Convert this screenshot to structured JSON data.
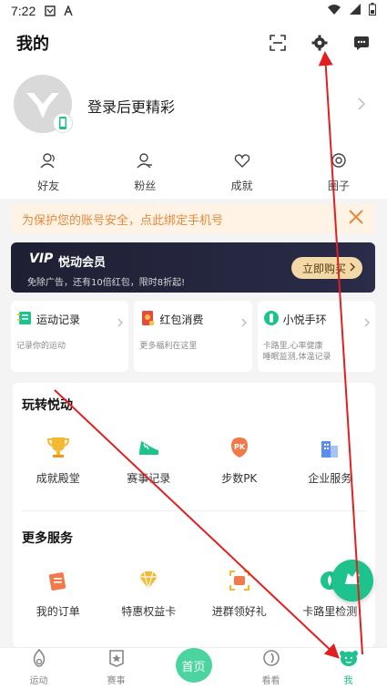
{
  "status_bar": {
    "time": "7:22"
  },
  "header": {
    "title": "我的"
  },
  "profile": {
    "login_text": "登录后更精彩"
  },
  "stats": [
    {
      "label": "好友",
      "icon": "friends-icon"
    },
    {
      "label": "粉丝",
      "icon": "fans-icon"
    },
    {
      "label": "成就",
      "icon": "heart-icon"
    },
    {
      "label": "圈子",
      "icon": "circle-icon"
    }
  ],
  "security_banner": {
    "text": "为保护您的账号安全，点此绑定手机号"
  },
  "vip": {
    "logo": "VIP",
    "title": "悦动会员",
    "subtitle": "免除广告，还有10倍红包，限时8折起!",
    "buy_label": "立即购买"
  },
  "shortcuts": [
    {
      "title": "运动记录",
      "desc": "记录你的运动"
    },
    {
      "title": "红包消费",
      "desc": "更多福利在这里"
    },
    {
      "title": "小悦手环",
      "desc": "卡路里,心率健康\n睡眠监测,体温记录"
    }
  ],
  "play": {
    "title": "玩转悦动",
    "items": [
      {
        "label": "成就殿堂",
        "icon": "trophy-icon"
      },
      {
        "label": "赛事记录",
        "icon": "shoe-icon"
      },
      {
        "label": "步数PK",
        "icon": "pk-icon"
      },
      {
        "label": "企业服务",
        "icon": "building-icon"
      }
    ]
  },
  "more": {
    "title": "更多服务",
    "items": [
      {
        "label": "我的订单",
        "icon": "order-icon"
      },
      {
        "label": "特惠权益卡",
        "icon": "diamond-icon"
      },
      {
        "label": "进群领好礼",
        "icon": "group-icon"
      },
      {
        "label": "卡路里检测",
        "icon": "calorie-icon"
      }
    ]
  },
  "bottom_nav": [
    {
      "label": "运动",
      "icon": "sport-icon"
    },
    {
      "label": "赛事",
      "icon": "event-icon"
    },
    {
      "label": "首页",
      "icon": "home-icon"
    },
    {
      "label": "看看",
      "icon": "look-icon"
    },
    {
      "label": "我",
      "icon": "me-icon"
    }
  ],
  "colors": {
    "accent": "#1dc28c",
    "warning": "#e58a3d",
    "vip_gold": "#f3d9a8",
    "annotation": "#e02020"
  }
}
